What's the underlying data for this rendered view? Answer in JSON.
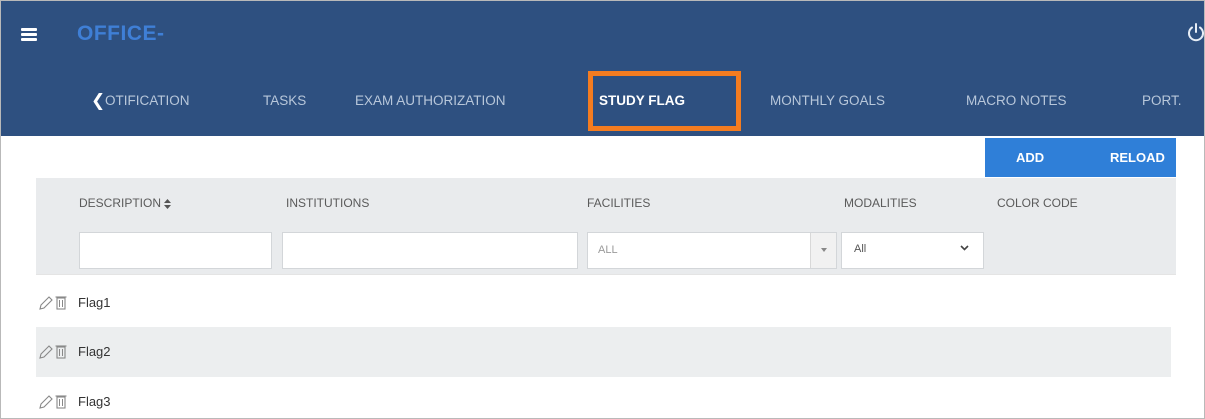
{
  "header": {
    "app_title": "OFFICE-"
  },
  "tabs": [
    {
      "label": "OTIFICATION"
    },
    {
      "label": "TASKS"
    },
    {
      "label": "EXAM AUTHORIZATION"
    },
    {
      "label": "STUDY FLAG",
      "active": true
    },
    {
      "label": "MONTHLY GOALS"
    },
    {
      "label": "MACRO NOTES"
    },
    {
      "label": "PORT."
    }
  ],
  "actions": {
    "add": "ADD",
    "reload": "RELOAD"
  },
  "columns": [
    {
      "label": "DESCRIPTION"
    },
    {
      "label": "INSTITUTIONS"
    },
    {
      "label": "FACILITIES"
    },
    {
      "label": "MODALITIES"
    },
    {
      "label": "COLOR CODE"
    }
  ],
  "filters": {
    "description": "",
    "institutions": "",
    "facilities": "ALL",
    "modalities": "All"
  },
  "rows": [
    {
      "description": "Flag1"
    },
    {
      "description": "Flag2"
    },
    {
      "description": "Flag3"
    }
  ],
  "colors": {
    "header_bg": "#2e5080",
    "button_bg": "#2f7fd8",
    "highlight": "#f47c20",
    "grid_header_bg": "#e9ebed",
    "row_alt_bg": "#eceeef"
  }
}
